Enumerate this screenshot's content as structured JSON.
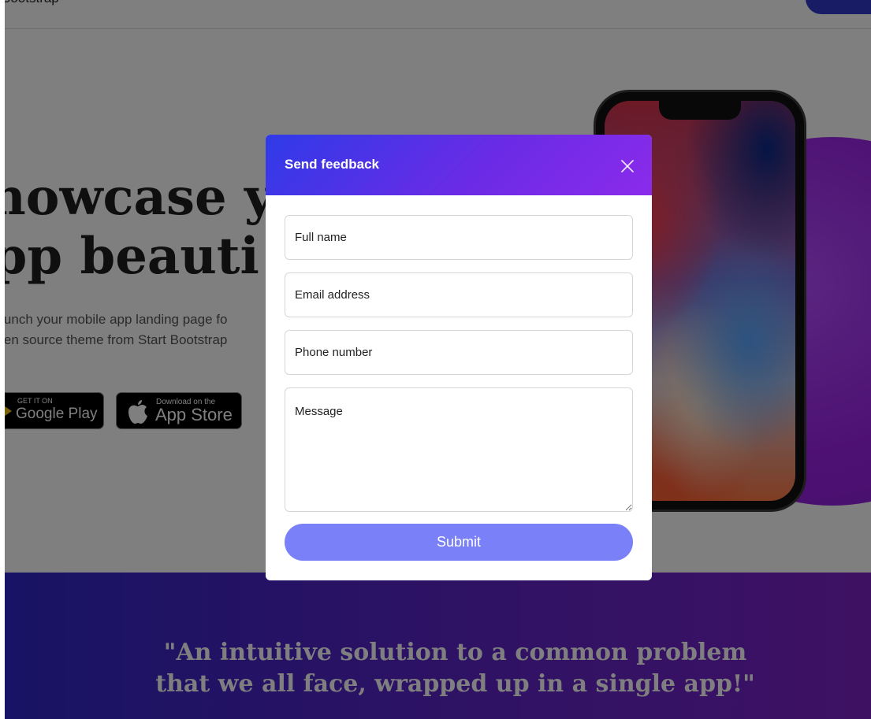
{
  "topbar": {
    "brand": "Bootstrap"
  },
  "hero": {
    "title_line1": "Showcase y",
    "title_line2": "App beauti",
    "subtitle_line1": "Launch your mobile app landing page fo",
    "subtitle_line2": "open source theme from Start Bootstrap"
  },
  "badges": {
    "google_small": "GET IT ON",
    "google_big": "Google Play",
    "apple_small": "Download on the",
    "apple_big": "App Store"
  },
  "modal": {
    "title": "Send feedback",
    "fields": {
      "full_name": "Full name",
      "email": "Email address",
      "phone": "Phone number",
      "message": "Message"
    },
    "submit_label": "Submit"
  },
  "quote": {
    "line1": "\"An intuitive solution to a common problem",
    "line2": "that we all face, wrapped up in a single app!\""
  },
  "colors": {
    "modal_header_start": "#2f3be8",
    "modal_header_end": "#8b2bea",
    "submit_button": "#7a80f7",
    "band_start": "#2f27c9",
    "band_end": "#7d23c7",
    "circle": "#9b22e6"
  },
  "icons": {
    "close": "close-icon",
    "google_play": "google-play-icon",
    "apple": "apple-icon"
  }
}
